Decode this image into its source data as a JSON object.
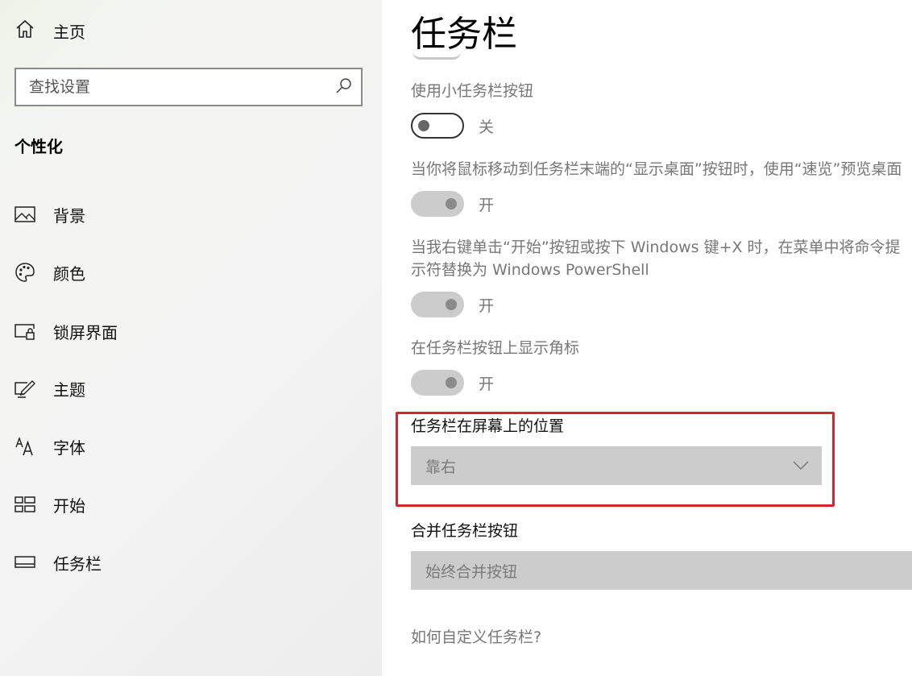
{
  "sidebar": {
    "home": {
      "label": "主页",
      "icon": "home-icon"
    },
    "search": {
      "placeholder": "查找设置",
      "icon": "search-icon"
    },
    "section_title": "个性化",
    "items": [
      {
        "label": "背景",
        "icon": "picture-icon"
      },
      {
        "label": "颜色",
        "icon": "palette-icon"
      },
      {
        "label": "锁屏界面",
        "icon": "lock-screen-icon"
      },
      {
        "label": "主题",
        "icon": "theme-brush-icon"
      },
      {
        "label": "字体",
        "icon": "font-icon"
      },
      {
        "label": "开始",
        "icon": "start-grid-icon"
      },
      {
        "label": "任务栏",
        "icon": "taskbar-icon"
      }
    ]
  },
  "main": {
    "title": "任务栏",
    "settings": [
      {
        "label": "使用小任务栏按钮",
        "state": "关",
        "on": false,
        "enabled": true
      },
      {
        "label": "当你将鼠标移动到任务栏末端的“显示桌面”按钮时，使用“速览”预览桌面",
        "state": "开",
        "on": true,
        "enabled": false
      },
      {
        "label_line1": "当我右键单击“开始”按钮或按下 Windows 键+X 时，在菜单中将命令提",
        "label_line2": "示符替换为 Windows PowerShell",
        "state": "开",
        "on": true,
        "enabled": false
      },
      {
        "label": "在任务栏按钮上显示角标",
        "state": "开",
        "on": true,
        "enabled": false
      }
    ],
    "position": {
      "label": "任务栏在屏幕上的位置",
      "value": "靠右",
      "icon": "chevron-down-icon",
      "highlight_color": "#d9232f"
    },
    "combine": {
      "label": "合并任务栏按钮",
      "value": "始终合并按钮"
    },
    "help_link": "如何自定义任务栏?"
  }
}
